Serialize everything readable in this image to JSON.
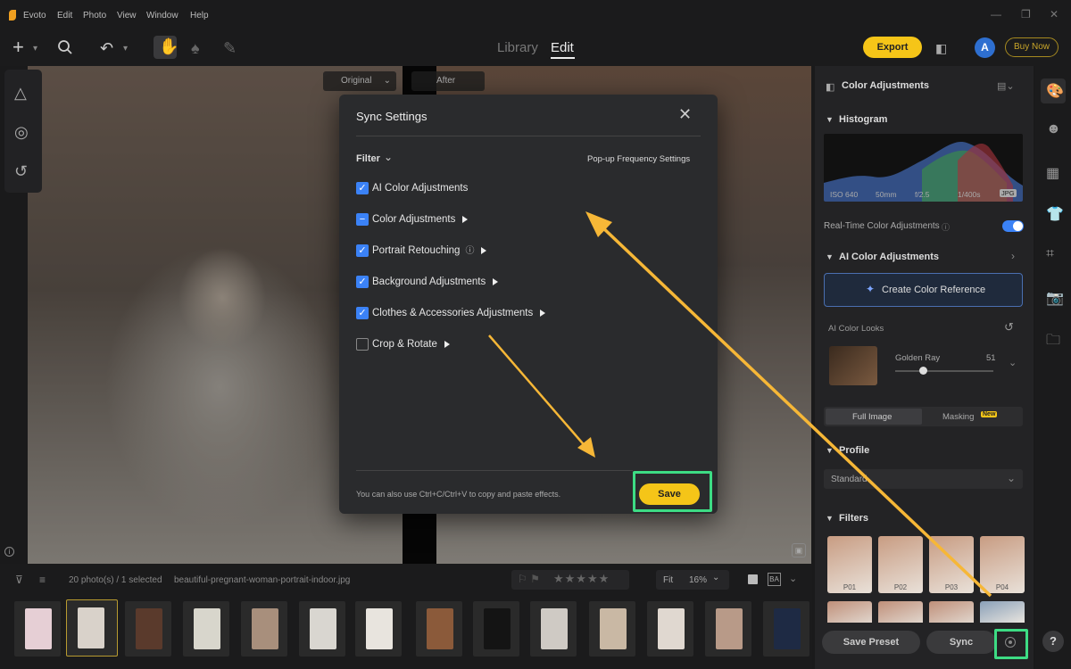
{
  "app": {
    "name": "Evoto"
  },
  "menu": [
    "Edit",
    "Photo",
    "View",
    "Window",
    "Help"
  ],
  "toolbar": {
    "tabs": {
      "library": "Library",
      "edit": "Edit"
    },
    "export_label": "Export",
    "avatar_letter": "A",
    "buy_label": "Buy Now"
  },
  "canvas": {
    "original_label": "Original",
    "after_label": "After"
  },
  "dialog": {
    "title": "Sync Settings",
    "filter_label": "Filter",
    "popup_settings_label": "Pop-up Frequency Settings",
    "items": [
      {
        "label": "AI Color Adjustments",
        "state": "checked"
      },
      {
        "label": "Color Adjustments",
        "state": "partial"
      },
      {
        "label": "Portrait Retouching",
        "state": "checked"
      },
      {
        "label": "Background Adjustments",
        "state": "checked"
      },
      {
        "label": "Clothes & Accessories Adjustments",
        "state": "checked"
      },
      {
        "label": "Crop & Rotate",
        "state": "unchecked"
      }
    ],
    "hint": "You can also use Ctrl+C/Ctrl+V to copy and paste effects.",
    "save_label": "Save"
  },
  "filmstrip": {
    "count_label": "20 photo(s) / 1 selected",
    "filename": "beautiful-pregnant-woman-portrait-indoor.jpg",
    "fit_label": "Fit",
    "zoom": "16%"
  },
  "right_panel": {
    "title": "Color Adjustments",
    "histogram_title": "Histogram",
    "exif": {
      "iso": "ISO 640",
      "focal": "50mm",
      "aperture": "f/2.5",
      "shutter": "1/400s",
      "format": "JPG"
    },
    "realtime_label": "Real-Time Color Adjustments",
    "ai_section": "AI Color Adjustments",
    "create_ref_label": "Create Color Reference",
    "looks_label": "AI Color Looks",
    "look_name": "Golden Ray",
    "look_value": "51",
    "full_image_tab": "Full Image",
    "masking_tab": "Masking",
    "new_badge": "New",
    "profile_title": "Profile",
    "profile_value": "Standard",
    "filters_title": "Filters",
    "filters": [
      "P01",
      "P02",
      "P03",
      "P04"
    ],
    "save_preset_label": "Save Preset",
    "sync_label": "Sync"
  },
  "colors": {
    "accent": "#f5c518",
    "checkbox": "#3b82f6",
    "highlight": "#3ddc84",
    "arrow": "#f6b737"
  }
}
